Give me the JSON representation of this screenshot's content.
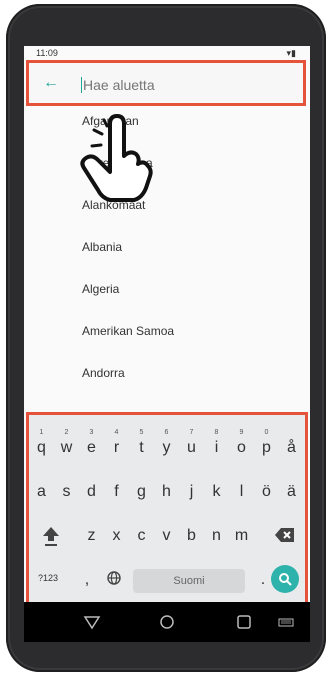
{
  "status": {
    "time": "11:09",
    "signal": "▾▮"
  },
  "search": {
    "back_icon": "arrow-left-icon",
    "placeholder": "Hae aluetta"
  },
  "countries": [
    "Afganistan",
    "Ahvenanmaa",
    "Alankomaat",
    "Albania",
    "Algeria",
    "Amerikan Samoa",
    "Andorra"
  ],
  "keyboard": {
    "row1": [
      {
        "k": "q",
        "n": "1"
      },
      {
        "k": "w",
        "n": "2"
      },
      {
        "k": "e",
        "n": "3"
      },
      {
        "k": "r",
        "n": "4"
      },
      {
        "k": "t",
        "n": "5"
      },
      {
        "k": "y",
        "n": "6"
      },
      {
        "k": "u",
        "n": "7"
      },
      {
        "k": "i",
        "n": "8"
      },
      {
        "k": "o",
        "n": "9"
      },
      {
        "k": "p",
        "n": "0"
      },
      {
        "k": "å",
        "n": ""
      }
    ],
    "row2": [
      "a",
      "s",
      "d",
      "f",
      "g",
      "h",
      "j",
      "k",
      "l",
      "ö",
      "ä"
    ],
    "row3": [
      "z",
      "x",
      "c",
      "v",
      "b",
      "n",
      "m"
    ],
    "row4": {
      "symbols": "?123",
      "comma": ",",
      "space": "Suomi",
      "period": "."
    }
  },
  "colors": {
    "accent": "#1fa79a",
    "highlight": "#e5533a",
    "go": "#2db3ab"
  }
}
